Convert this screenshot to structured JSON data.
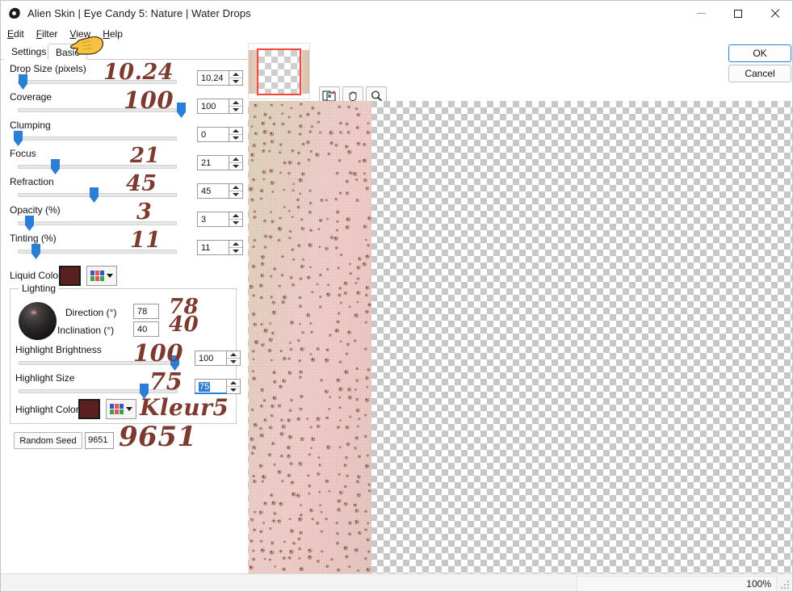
{
  "window": {
    "title": "Alien Skin | Eye Candy 5: Nature | Water Drops",
    "app_icon": "alienskin-logo-icon",
    "minimize_label": "",
    "maximize_label": "",
    "close_label": ""
  },
  "menubar": {
    "items": [
      {
        "label": "Edit",
        "mnemonic": "E"
      },
      {
        "label": "Filter",
        "mnemonic": "F"
      },
      {
        "label": "View",
        "mnemonic": "V"
      },
      {
        "label": "Help",
        "mnemonic": "H"
      }
    ]
  },
  "tabs": [
    {
      "label": "Settings",
      "active": false
    },
    {
      "label": "Basic",
      "active": true
    }
  ],
  "parameters": [
    {
      "label": "Drop Size (pixels)",
      "value": "10.24",
      "annotation": "10.24",
      "thumb_pct": 3
    },
    {
      "label": "Coverage",
      "value": "100",
      "annotation": "100",
      "thumb_pct": 100
    },
    {
      "label": "Clumping",
      "value": "0",
      "annotation": "",
      "thumb_pct": 0
    },
    {
      "label": "Focus",
      "value": "21",
      "annotation": "21",
      "thumb_pct": 24
    },
    {
      "label": "Refraction",
      "value": "45",
      "annotation": "45",
      "thumb_pct": 48
    },
    {
      "label": "Opacity (%)",
      "value": "3",
      "annotation": "3",
      "thumb_pct": 12
    },
    {
      "label": "Tinting (%)",
      "value": "11",
      "annotation": "11",
      "thumb_pct": 13
    }
  ],
  "liquid_color": {
    "label": "Liquid Color",
    "swatch_hex": "#5a2020",
    "palette_icon": "color-palette-icon",
    "dropdown_icon": "chevron-down-icon"
  },
  "lighting": {
    "legend": "Lighting",
    "sphere_icon": "light-direction-sphere-icon",
    "direction": {
      "label": "Direction (°)",
      "value": "78",
      "annotation": "78"
    },
    "inclination": {
      "label": "Inclination (°)",
      "value": "40",
      "annotation": "40"
    },
    "highlight_brightness": {
      "label": "Highlight Brightness",
      "value": "100",
      "annotation": "100",
      "thumb_pct": 94
    },
    "highlight_size": {
      "label": "Highlight Size",
      "value": "75",
      "annotation": "75",
      "thumb_pct": 71,
      "selected": true
    },
    "highlight_color": {
      "label": "Highlight Color",
      "swatch_hex": "#5a2020",
      "annotation": "Kleur5",
      "palette_icon": "color-palette-icon",
      "dropdown_icon": "chevron-down-icon"
    }
  },
  "random_seed": {
    "button_label": "Random Seed",
    "value": "9651",
    "annotation": "9651"
  },
  "preview": {
    "navigator_icon": "navigator-thumbnail",
    "viewport_color": "#f4453c",
    "tools": [
      {
        "name": "preview-toggle-icon",
        "label": ""
      },
      {
        "name": "pan-hand-icon",
        "label": ""
      },
      {
        "name": "zoom-magnifier-icon",
        "label": ""
      }
    ]
  },
  "buttons": {
    "ok": "OK",
    "cancel": "Cancel"
  },
  "statusbar": {
    "zoom": "100%",
    "resize_grip_icon": "resize-grip-icon"
  },
  "cursor": {
    "icon": "pointing-hand-cursor"
  },
  "colors": {
    "accent": "#2a7fd4",
    "annotation": "#7d3a2e",
    "swatch": "#5a2020"
  }
}
